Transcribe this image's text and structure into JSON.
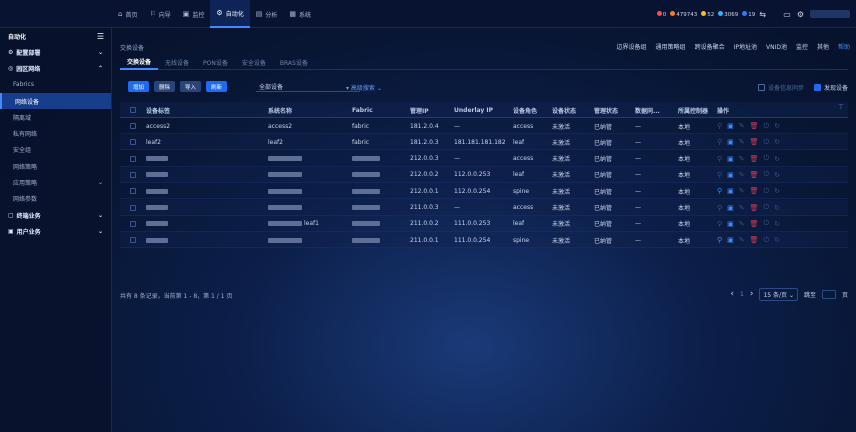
{
  "topnav": [
    {
      "icon": "⌂",
      "label": "首页",
      "active": false
    },
    {
      "icon": "⚐",
      "label": "向导",
      "active": false
    },
    {
      "icon": "▣",
      "label": "监控",
      "active": false
    },
    {
      "icon": "⚙",
      "label": "自动化",
      "active": true
    },
    {
      "icon": "▤",
      "label": "分析",
      "active": false
    },
    {
      "icon": "▦",
      "label": "系统",
      "active": false
    }
  ],
  "status": [
    {
      "color": "#ff4d4f",
      "text": "0"
    },
    {
      "color": "#ff7a1a",
      "text": "479743"
    },
    {
      "color": "#f6c21a",
      "text": "52"
    },
    {
      "color": "#29b6f6",
      "text": "3069"
    },
    {
      "color": "#2d7cf6",
      "text": "19"
    }
  ],
  "sidebar": {
    "title": "自动化",
    "items": [
      {
        "label": "配置部署",
        "type": "top",
        "icon": "⚙",
        "arrow": "⌄"
      },
      {
        "label": "园区网络",
        "type": "top",
        "icon": "◎",
        "arrow": "⌃"
      },
      {
        "label": "Fabrics",
        "type": "sub",
        "arrow": ""
      },
      {
        "label": "网络设备",
        "type": "sub",
        "active": true,
        "arrow": ""
      },
      {
        "label": "隔离域",
        "type": "sub",
        "arrow": ""
      },
      {
        "label": "私有网络",
        "type": "sub",
        "arrow": ""
      },
      {
        "label": "安全组",
        "type": "sub",
        "arrow": ""
      },
      {
        "label": "网络策略",
        "type": "sub",
        "arrow": ""
      },
      {
        "label": "应用策略",
        "type": "sub",
        "arrow": "⌄"
      },
      {
        "label": "网络参数",
        "type": "sub",
        "arrow": ""
      },
      {
        "label": "终端业务",
        "type": "top",
        "icon": "▢",
        "arrow": "⌄"
      },
      {
        "label": "用户业务",
        "type": "top",
        "icon": "▣",
        "arrow": "⌄"
      }
    ]
  },
  "breadcrumb": "交换设备",
  "right_tabs": [
    "边界设备组",
    "通用策略组",
    "跨设备聚合",
    "IP地址池",
    "VNID池",
    "监控",
    "其他",
    "帮助"
  ],
  "tabs": [
    "交换设备",
    "无线设备",
    "PON设备",
    "安全设备",
    "BRAS设备"
  ],
  "toolbar": {
    "buttons": [
      "增加",
      "删除",
      "导入",
      "刷新"
    ],
    "select_value": "全部设备",
    "advanced": "▾ 高级搜索 ⌄",
    "sync_label": "设备信息同步",
    "discover_label": "发现设备"
  },
  "columns": [
    "设备标签",
    "系统名称",
    "Fabric",
    "管理IP",
    "Underlay IP",
    "设备角色",
    "设备状态",
    "管理状态",
    "数据同...",
    "所属控制器",
    "操作"
  ],
  "rows": [
    {
      "label": "access2",
      "sysname": "access2",
      "fabric": "fabric",
      "ip": "181.2.0.4",
      "underlay": "—",
      "role": "access",
      "state": "未激活",
      "mgmt": "已纳管",
      "sync": "—",
      "ctrl": "本地",
      "mask": [
        false,
        false,
        false
      ],
      "first_act": "dim"
    },
    {
      "label": "leaf2",
      "sysname": "leaf2",
      "fabric": "fabric",
      "ip": "181.2.0.3",
      "underlay": "181.181.181.182",
      "role": "leaf",
      "state": "未激活",
      "mgmt": "已纳管",
      "sync": "—",
      "ctrl": "本地",
      "mask": [
        false,
        false,
        false
      ],
      "first_act": "dim"
    },
    {
      "label": "",
      "sysname": "",
      "fabric": "",
      "ip": "212.0.0.3",
      "underlay": "—",
      "role": "access",
      "state": "未激活",
      "mgmt": "已纳管",
      "sync": "—",
      "ctrl": "本地",
      "mask": [
        true,
        true,
        true
      ],
      "first_act": "dim"
    },
    {
      "label": "",
      "sysname": "",
      "fabric": "",
      "ip": "212.0.0.2",
      "underlay": "112.0.0.253",
      "role": "leaf",
      "state": "未激活",
      "mgmt": "已纳管",
      "sync": "—",
      "ctrl": "本地",
      "mask": [
        true,
        true,
        true
      ],
      "first_act": "dim"
    },
    {
      "label": "",
      "sysname": "",
      "fabric": "",
      "ip": "212.0.0.1",
      "underlay": "112.0.0.254",
      "role": "spine",
      "state": "未激活",
      "mgmt": "已纳管",
      "sync": "—",
      "ctrl": "本地",
      "mask": [
        true,
        true,
        true
      ],
      "first_act": "blue"
    },
    {
      "label": "",
      "sysname": "",
      "fabric": "",
      "ip": "211.0.0.3",
      "underlay": "—",
      "role": "access",
      "state": "未激活",
      "mgmt": "已纳管",
      "sync": "—",
      "ctrl": "本地",
      "mask": [
        true,
        true,
        true
      ],
      "first_act": "dim"
    },
    {
      "label": "",
      "sysname": "leaf1",
      "fabric": "",
      "ip": "211.0.0.2",
      "underlay": "111.0.0.253",
      "role": "leaf",
      "state": "未激活",
      "mgmt": "已纳管",
      "sync": "—",
      "ctrl": "本地",
      "mask": [
        true,
        true,
        true
      ],
      "first_act": "dim"
    },
    {
      "label": "",
      "sysname": "",
      "fabric": "",
      "ip": "211.0.0.1",
      "underlay": "111.0.0.254",
      "role": "spine",
      "state": "未激活",
      "mgmt": "已纳管",
      "sync": "—",
      "ctrl": "本地",
      "mask": [
        true,
        true,
        true
      ],
      "first_act": "blue"
    }
  ],
  "pager": {
    "total": "共有 8 条记录，当前第 1 - 8，第 1 / 1 页",
    "prev": "‹",
    "page": "1",
    "next": "›",
    "size": "15 条/页 ⌄",
    "goto": "跳至",
    "unit": "页"
  }
}
